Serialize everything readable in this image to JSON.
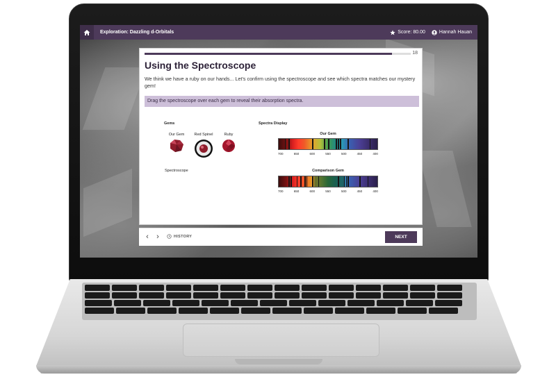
{
  "header": {
    "title": "Exploration: Dazzling d-Orbitals",
    "score": "Score: 80.00",
    "user": "Hannah Hauan",
    "icons": [
      "home-icon",
      "star-icon",
      "user-icon"
    ]
  },
  "progress": {
    "current": "18",
    "fraction": 0.93
  },
  "lesson": {
    "title": "Using the Spectroscope",
    "body": "We think we have a ruby on our hands... Let's confirm using the spectroscope and see which spectra matches our mystery gem!",
    "instruction": "Drag the spectroscope over each gem to reveal their absorption spectra."
  },
  "gems_panel": {
    "heading": "Gems",
    "items": [
      {
        "label": "Our Gem"
      },
      {
        "label": "Red Spinel"
      },
      {
        "label": "Ruby"
      }
    ],
    "tool_label": "Spectroscope"
  },
  "spectra_panel": {
    "heading": "Spectra Display",
    "spectra": [
      {
        "title": "Our Gem"
      },
      {
        "title": "Comparison Gem"
      }
    ],
    "tick_labels": [
      "700",
      "650",
      "600",
      "550",
      "500",
      "450",
      "400"
    ]
  },
  "footer": {
    "history_label": "HISTORY",
    "next_label": "NEXT"
  },
  "colors": {
    "brand": "#4d3a5a",
    "instruction_bg": "#cdbfd9"
  }
}
